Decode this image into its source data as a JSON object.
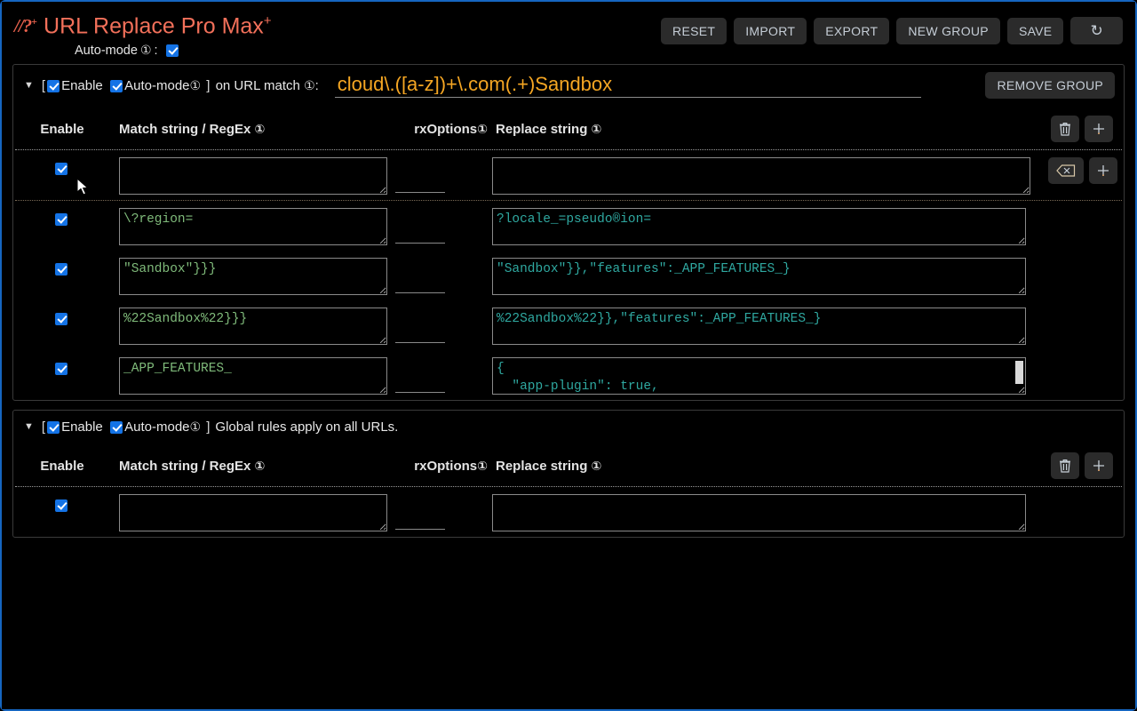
{
  "app": {
    "logo_glyph": "//?",
    "logo_sup": "+",
    "title": "URL Replace Pro Max",
    "title_sup": "+",
    "automode_label": "Auto-mode",
    "info_glyph": "①",
    "automode_colon": ":",
    "accent_title": "#f2705a",
    "accent_logo": "#e8614d",
    "accent_url": "#f5a623",
    "accent_match": "#7fba7a",
    "accent_replace": "#2fa8a0",
    "accent_checkbox": "#1473e6"
  },
  "toolbar": {
    "reset": "RESET",
    "import": "IMPORT",
    "export": "EXPORT",
    "new_group": "NEW GROUP",
    "save": "SAVE",
    "refresh_icon": "refresh-icon"
  },
  "columns": {
    "enable": "Enable",
    "match": "Match string / RegEx",
    "rxoptions": "rxOptions",
    "replace": "Replace string",
    "info_glyph": "①"
  },
  "groups": [
    {
      "caret": "▼",
      "open_bracket": "[",
      "close_bracket": "]",
      "enable_label": "Enable",
      "automode_label": "Auto-mode",
      "enabled": true,
      "automode": true,
      "prefix_text": "on URL match",
      "url_match": "cloud\\.([a-z])+\\.com(.+)Sandbox",
      "url_placeholder": "",
      "remove_label": "REMOVE GROUP",
      "global_note": "",
      "rules": [
        {
          "enabled": true,
          "match": "",
          "match_placeholder": "",
          "rxoptions": "",
          "replace": "",
          "replace_placeholder": "",
          "replace_short": true,
          "actions": [
            "erase-icon",
            "plus-icon"
          ],
          "has_scrollbar": false,
          "separator_after": true
        },
        {
          "enabled": true,
          "match": "\\?region=",
          "match_placeholder": "",
          "rxoptions": "",
          "replace": "?locale_=pseudo&region=",
          "replace_placeholder": "",
          "replace_short": false,
          "actions": [],
          "has_scrollbar": false,
          "separator_after": false
        },
        {
          "enabled": true,
          "match": "\"Sandbox\"}}}",
          "match_placeholder": "",
          "rxoptions": "",
          "replace": "\"Sandbox\"}},\"features\":_APP_FEATURES_}",
          "replace_placeholder": "",
          "replace_short": false,
          "actions": [],
          "has_scrollbar": false,
          "separator_after": false
        },
        {
          "enabled": true,
          "match": "%22Sandbox%22}}}",
          "match_placeholder": "",
          "rxoptions": "",
          "replace": "%22Sandbox%22}},\"features\":_APP_FEATURES_}",
          "replace_placeholder": "",
          "replace_short": false,
          "actions": [],
          "has_scrollbar": false,
          "separator_after": false
        },
        {
          "enabled": true,
          "match": "_APP_FEATURES_",
          "match_placeholder": "",
          "rxoptions": "",
          "replace": "{\n  \"app-plugin\": true,",
          "replace_placeholder": "",
          "replace_short": false,
          "actions": [],
          "has_scrollbar": true,
          "separator_after": false
        }
      ]
    },
    {
      "caret": "▼",
      "open_bracket": "[",
      "close_bracket": "]",
      "enable_label": "Enable",
      "automode_label": "Auto-mode",
      "enabled": true,
      "automode": true,
      "prefix_text": "",
      "url_match": "",
      "url_placeholder": "",
      "remove_label": "",
      "global_note": "Global rules apply on all URLs.",
      "rules": [
        {
          "enabled": true,
          "match": "",
          "match_placeholder": "",
          "rxoptions": "",
          "replace": "",
          "replace_placeholder": "",
          "replace_short": false,
          "actions": [],
          "has_scrollbar": false,
          "separator_after": false
        }
      ]
    }
  ],
  "group_actions": {
    "delete_icon": "trash-icon",
    "add_icon": "plus-icon",
    "erase_icon": "erase-icon"
  }
}
